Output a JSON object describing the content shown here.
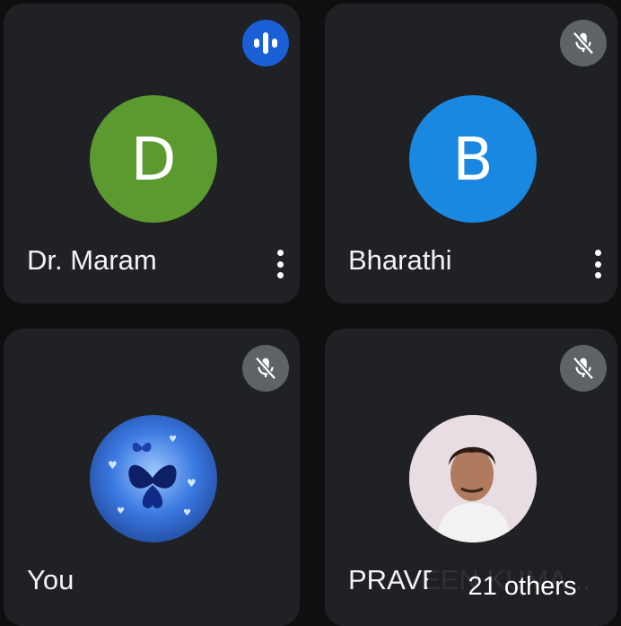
{
  "participants": [
    {
      "name": "Dr. Maram",
      "initial": "D",
      "avatar_color": "#5a9a2f",
      "mic": "speaking"
    },
    {
      "name": "Bharathi",
      "initial": "B",
      "avatar_color": "#1a88e0",
      "mic": "muted"
    },
    {
      "name": "You",
      "initial": "",
      "avatar_color": "#1b3f9a",
      "mic": "muted"
    },
    {
      "name": "PRAVEEN KUMA...",
      "initial": "",
      "avatar_color": "#d9cbd0",
      "mic": "muted"
    }
  ],
  "overflow_label": "21 others",
  "colors": {
    "tile_bg": "#202124",
    "background": "#0f0f10",
    "speaking_badge": "#1a5fd6",
    "muted_badge": "#5f6368"
  },
  "icons": {
    "speaking": "audio-level-icon",
    "muted": "mic-off-icon",
    "menu": "more-vert-icon"
  }
}
